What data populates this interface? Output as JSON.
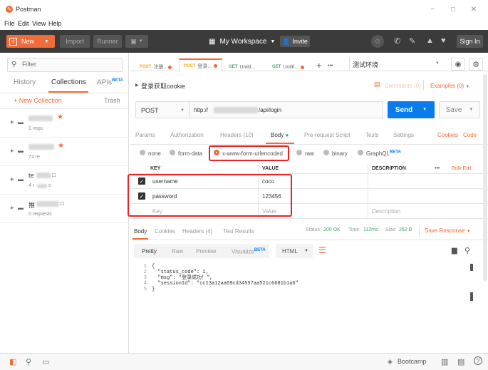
{
  "window": {
    "app_title": "Postman",
    "minimize": "−",
    "maximize": "□",
    "close": "✕"
  },
  "menu": [
    "File",
    "Edit",
    "View",
    "Help"
  ],
  "header": {
    "new_label": "New",
    "import_label": "Import",
    "runner_label": "Runner",
    "workspace_label": "My Workspace",
    "invite_label": "Invite",
    "signin_label": "Sign In"
  },
  "sidebar": {
    "filter_placeholder": "Filter",
    "tabs": {
      "history": "History",
      "collections": "Collections",
      "apis": "APIs",
      "apis_badge": "BETA"
    },
    "new_collection": "+ New Collection",
    "trash": "Trash",
    "collections": [
      {
        "name": "",
        "meta": "1 requ"
      },
      {
        "name": "",
        "meta": "72 re"
      },
      {
        "name": "te",
        "meta": "4 r",
        "meta_tail": "s"
      },
      {
        "name": "推",
        "meta": "0 requests"
      }
    ]
  },
  "request_tabs": [
    {
      "method": "POST",
      "name": "注册..",
      "dirty": true
    },
    {
      "method": "POST",
      "name": "登录...",
      "dirty": true,
      "active": true
    },
    {
      "method": "GET",
      "name": "Untitl...",
      "dirty": false
    },
    {
      "method": "GET",
      "name": "Untitl...",
      "dirty": true
    }
  ],
  "add_tab": "+",
  "more_tabs": "•••",
  "environment": "测试环境",
  "request": {
    "title": "登录获取cookie",
    "comments": "Comments (0)",
    "examples": "Examples (0)",
    "method": "POST",
    "url_prefix": "http://",
    "url_suffix": "/api/login",
    "send": "Send",
    "save": "Save"
  },
  "req_subtabs": {
    "params": "Params",
    "authorization": "Authorization",
    "headers": "Headers (10)",
    "body": "Body",
    "prerequest": "Pre-request Script",
    "tests": "Tests",
    "settings": "Settings",
    "cookies": "Cookies",
    "code": "Code"
  },
  "body_types": {
    "none": "none",
    "form_data": "form-data",
    "urlencoded": "x-www-form-urlencoded",
    "raw": "raw",
    "binary": "binary",
    "graphql": "GraphQL",
    "graphql_badge": "BETA"
  },
  "kv_table": {
    "headers": {
      "key": "KEY",
      "value": "VALUE",
      "description": "DESCRIPTION",
      "more": "•••",
      "bulk_edit": "Bulk Edit"
    },
    "rows": [
      {
        "key": "username",
        "value": "coco",
        "checked": true
      },
      {
        "key": "password",
        "value": "123456",
        "checked": true
      }
    ],
    "placeholder": {
      "key": "Key",
      "value": "Value",
      "description": "Description"
    }
  },
  "response": {
    "tabs": {
      "body": "Body",
      "cookies": "Cookies",
      "headers": "Headers (4)",
      "tests": "Test Results"
    },
    "status_label": "Status:",
    "status_value": "200 OK",
    "time_label": "Time:",
    "time_value": "112ms",
    "size_label": "Size:",
    "size_value": "262 B",
    "save_response": "Save Response",
    "view_tabs": {
      "pretty": "Pretty",
      "raw": "Raw",
      "preview": "Preview",
      "visualize": "Visualize",
      "visualize_badge": "BETA"
    },
    "format": "HTML",
    "code_lines": [
      {
        "n": "1",
        "text": "{"
      },
      {
        "n": "2",
        "text": "  \"status_code\": 1,"
      },
      {
        "n": "3",
        "text": "  \"msg\": \"登录成功！\","
      },
      {
        "n": "4",
        "text": "  \"sessionId\": \"cc13a12aa69cd34557aa521c6681b1a6\""
      },
      {
        "n": "5",
        "text": "}"
      }
    ]
  },
  "statusbar": {
    "bootcamp": "Bootcamp"
  },
  "colors": {
    "orange": "#f26b3a",
    "blue": "#097bed",
    "green": "#49a36b",
    "header_bg": "#3b3b3b"
  }
}
